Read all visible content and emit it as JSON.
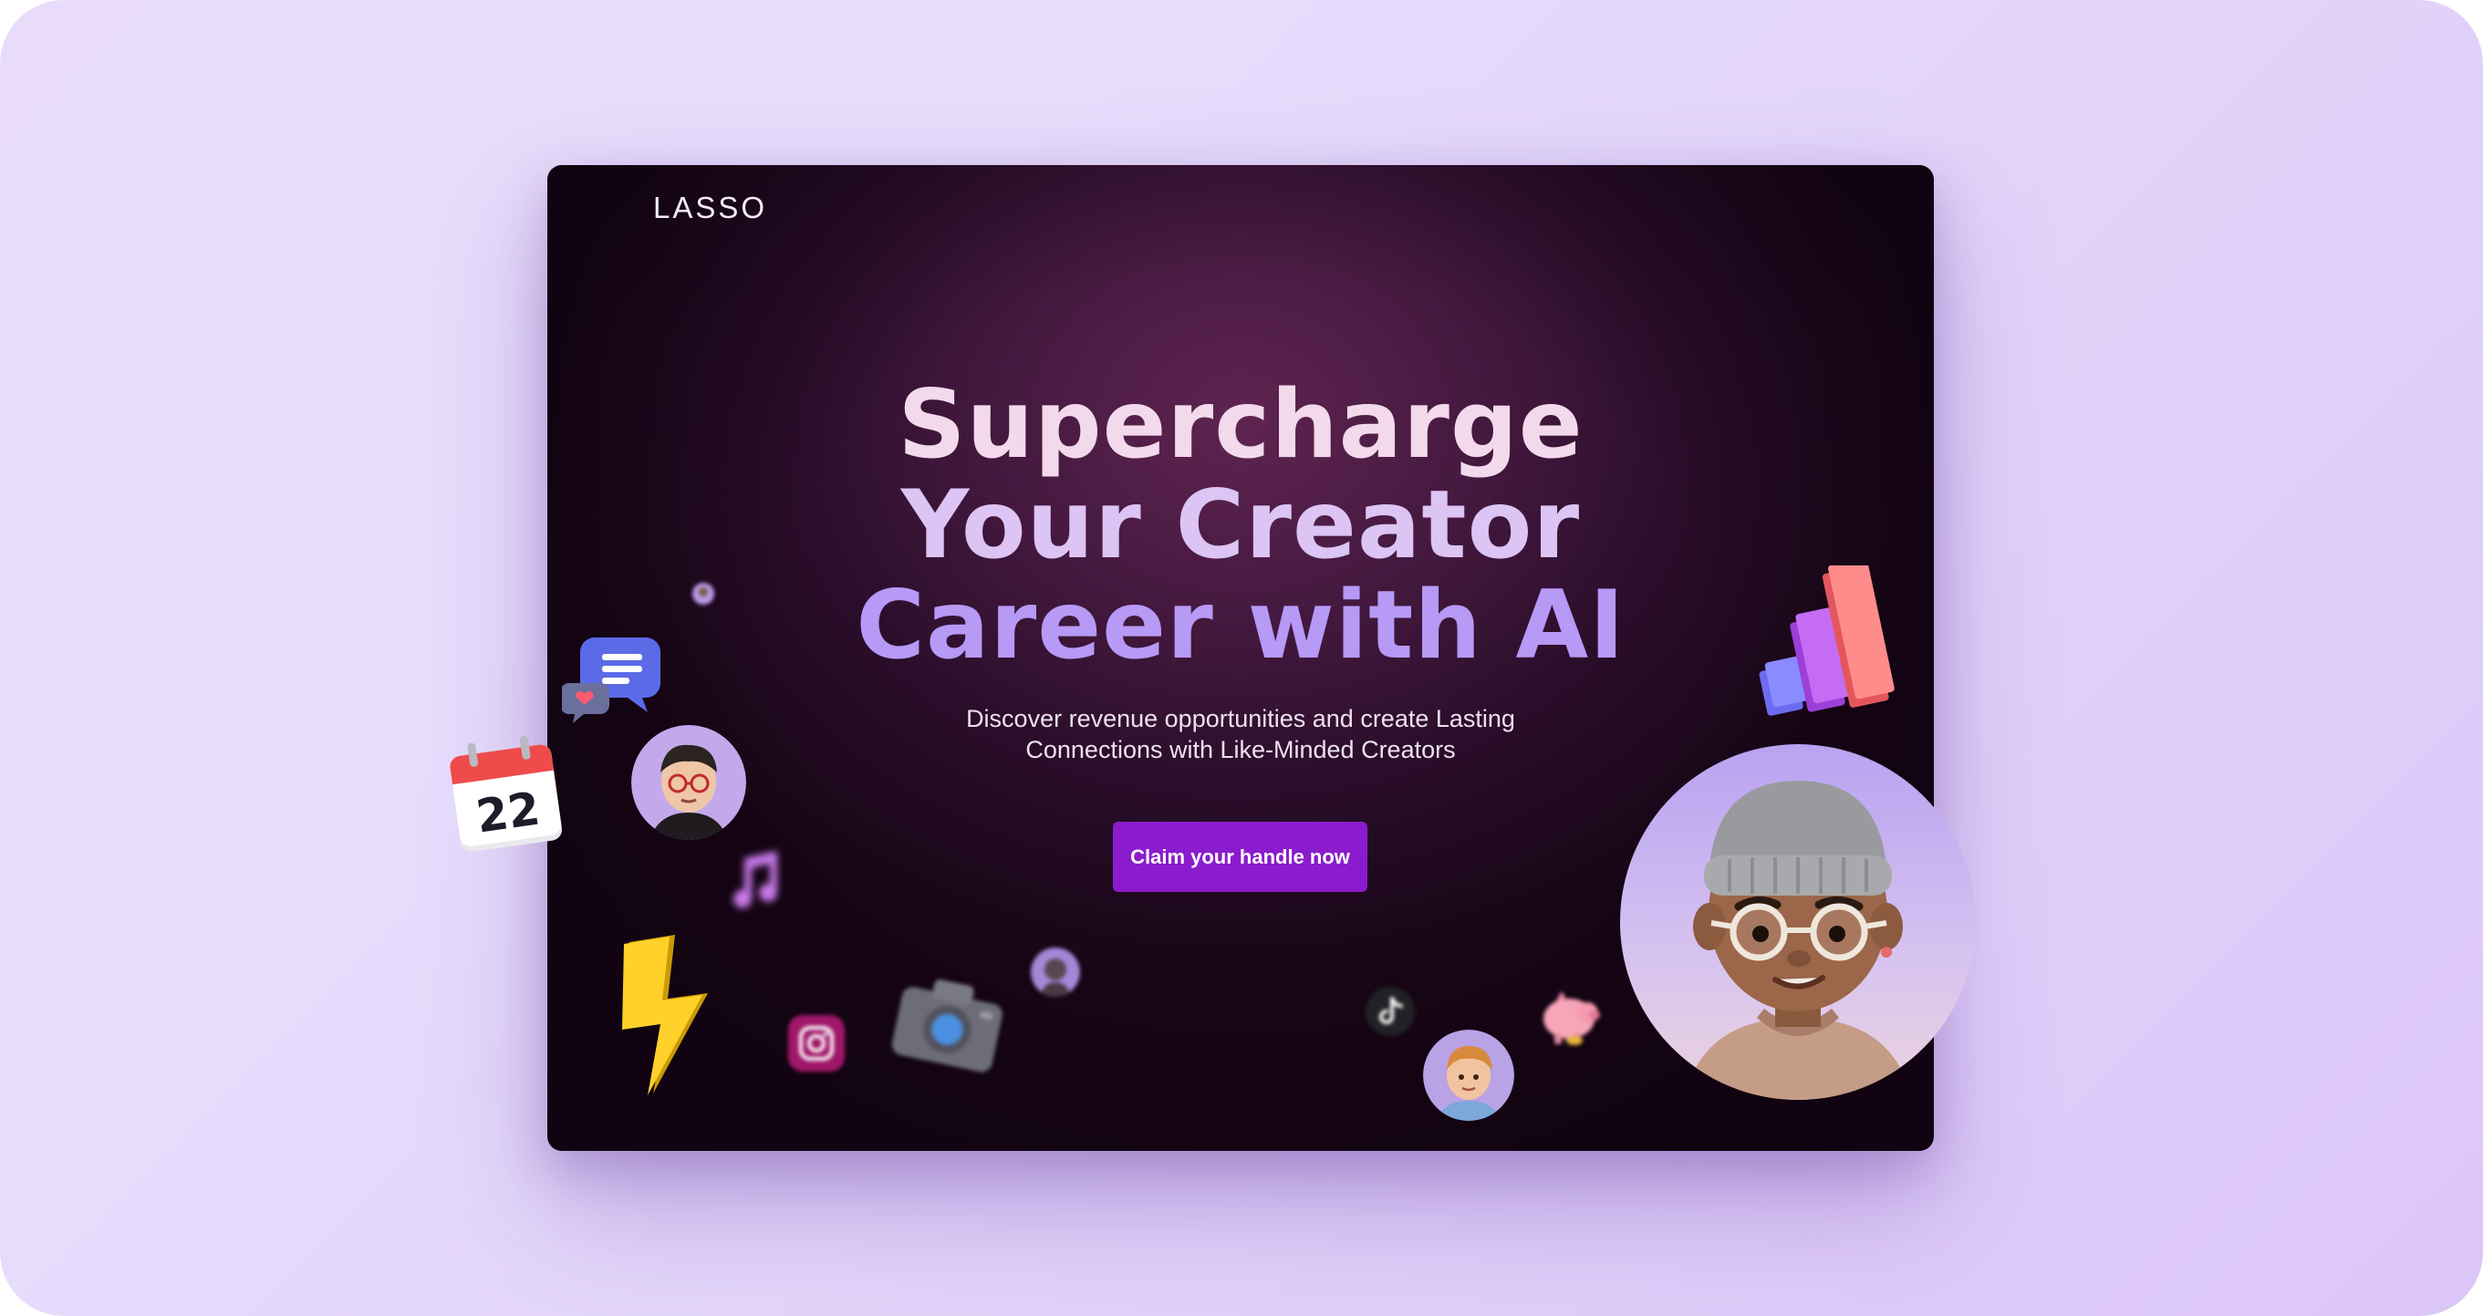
{
  "brand": {
    "logo_text": "LASSO"
  },
  "hero": {
    "headline_line_1": "Supercharge",
    "headline_line_2": "Your Creator",
    "headline_line_3": "Career with AI",
    "subtitle_line_1": "Discover revenue opportunities and create Lasting",
    "subtitle_line_2": "Connections with Like-Minded Creators",
    "cta_label": "Claim your handle now"
  },
  "decorations": {
    "calendar_day": "22",
    "icons": [
      "chat-bubbles-icon",
      "calendar-icon",
      "music-note-icon",
      "lightning-bolt-icon",
      "instagram-icon",
      "camera-icon",
      "tiktok-icon",
      "piggy-bank-icon",
      "bar-chart-icon"
    ],
    "avatars": [
      "avatar-glasses-creator",
      "avatar-small-round",
      "avatar-boy",
      "avatar-large-beanie-creator"
    ]
  },
  "colors": {
    "accent": "#8a1ccd",
    "headline_pink": "#f3d9ec",
    "headline_lilac": "#dcc4f4",
    "headline_violet": "#b799f6",
    "page_background": "#e7ddfc"
  }
}
